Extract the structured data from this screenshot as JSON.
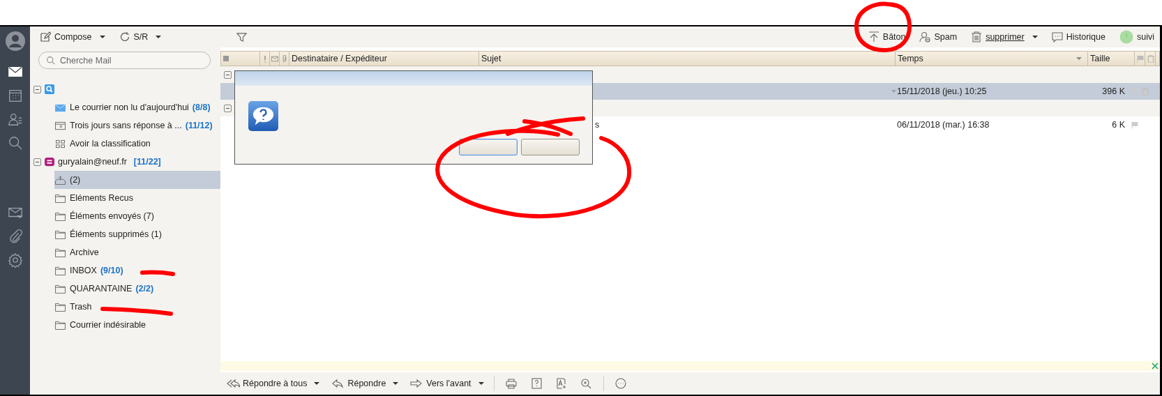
{
  "toolbar": {
    "left": [
      {
        "kind": "compose",
        "label": "Compose",
        "dropdown": true
      },
      {
        "kind": "sync",
        "label": "S/R",
        "dropdown": true
      }
    ],
    "right": [
      {
        "kind": "upload",
        "label": "Bâton",
        "dropdown": false
      },
      {
        "kind": "spam",
        "label": "Spam",
        "dropdown": false
      },
      {
        "kind": "trash",
        "label": "supprimer",
        "dropdown": true
      },
      {
        "kind": "chat",
        "label": "Historique",
        "dropdown": false
      },
      {
        "kind": "status",
        "label": "suivi",
        "dropdown": false
      }
    ]
  },
  "side_nav": [
    {
      "kind": "mail",
      "selected": true
    },
    {
      "kind": "calendar",
      "selected": false
    },
    {
      "kind": "contacts",
      "selected": false
    },
    {
      "kind": "search",
      "selected": false
    },
    {
      "kind": "filter",
      "selected": false
    },
    {
      "kind": "attachment",
      "selected": false
    },
    {
      "kind": "settings",
      "selected": false
    }
  ],
  "search": {
    "placeholder": "Cherche Mail"
  },
  "tree": [
    {
      "kind": "search",
      "expanded": true,
      "children": [
        {
          "kind": "unread",
          "label": "Le courrier non lu d'aujourd'hui",
          "count": "(8/8)",
          "selected": false
        },
        {
          "kind": "saved",
          "label": "Trois jours sans réponse à ...",
          "count": "(11/12)",
          "selected": false
        },
        {
          "kind": "grid",
          "label": "Avoir la classification",
          "selected": false
        }
      ]
    },
    {
      "kind": "account",
      "label": "guryalain@neuf.fr",
      "count": "[11/22]",
      "expanded": true,
      "children": [
        {
          "kind": "outbox",
          "label": "(2)",
          "selected": true
        },
        {
          "kind": "folder",
          "label": "Eléments Recus",
          "selected": false
        },
        {
          "kind": "folder",
          "label": "Éléments envoyés (7)",
          "selected": false
        },
        {
          "kind": "folder",
          "label": "Éléments supprimés (1)",
          "selected": false
        },
        {
          "kind": "folder",
          "label": "Archive",
          "selected": false
        },
        {
          "kind": "folder",
          "label": "INBOX",
          "count": "(9/10)",
          "selected": false
        },
        {
          "kind": "folder",
          "label": "QUARANTAINE",
          "count": "(2/2)",
          "selected": false
        },
        {
          "kind": "folder",
          "label": "Trash",
          "selected": false
        },
        {
          "kind": "folder",
          "label": "Courrier indésirable",
          "selected": false
        }
      ]
    }
  ],
  "table": {
    "columns": [
      "Destinataire / Expéditeur",
      "Sujet",
      "Temps",
      "Taille"
    ],
    "rows": [
      {
        "kind": "group",
        "expanded": true
      },
      {
        "kind": "message",
        "selected": true,
        "time": "15/11/2018 (jeu.) 10:25",
        "size": "396 K",
        "trash": true
      },
      {
        "kind": "group",
        "expanded": true
      },
      {
        "kind": "message",
        "selected": false,
        "subject": "s",
        "time": "06/11/2018 (mar.) 16:38",
        "size": "6 K",
        "trash": false
      }
    ]
  },
  "dialog": {
    "kind": "question",
    "buttons": [
      {
        "focused": true
      },
      {
        "focused": false
      }
    ]
  },
  "bottom_toolbar": [
    {
      "kind": "reply-all",
      "label": "Répondre à tous",
      "dropdown": true
    },
    {
      "kind": "reply",
      "label": "Répondre",
      "dropdown": true
    },
    {
      "kind": "forward",
      "label": "Vers l'avant",
      "dropdown": true
    },
    {
      "kind": "print",
      "dropdown": false
    },
    {
      "kind": "help",
      "dropdown": false
    },
    {
      "kind": "font",
      "dropdown": false
    },
    {
      "kind": "zoom",
      "dropdown": false
    },
    {
      "kind": "more",
      "dropdown": false
    }
  ],
  "annotations": [
    {
      "kind": "circle"
    },
    {
      "kind": "loop"
    },
    {
      "kind": "cross"
    },
    {
      "kind": "underline-inbox"
    },
    {
      "kind": "underline-trash"
    }
  ]
}
